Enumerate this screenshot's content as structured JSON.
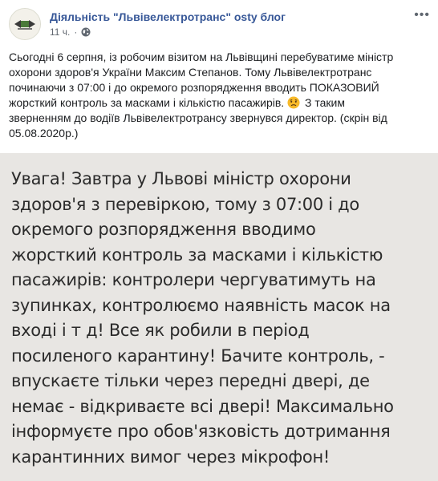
{
  "post": {
    "page_name": "Діяльність \"Львівелектротранс\" osty блог",
    "time": "11 ч.",
    "meta_separator": "·",
    "audience_icon": "globe-icon",
    "more_icon": "more-options-icon",
    "text_before_emoji": "Сьогодні 6 серпня, із робочим візитом на Львівщині перебуватиме міністр охорони здоров'я України Максим Степанов. Тому Львівелектротранс починаючи з 07:00 і до окремого розпорядження вводить ПОКАЗОВИЙ жорсткий контроль за масками і кількістю пасажирів.",
    "emoji_icon": "disappointed-face-icon",
    "text_after_emoji": "З таким зверненням до водіїв Львівелектротрансу звернувся директор. (скрін від 05.08.2020р.)"
  },
  "screenshot": {
    "text": "Увага! Завтра у Львові міністр охорони\nздоров'я з перевіркою, тому з 07:00  і до\nокремого розпорядження вводимо\nжорсткий контроль за масками і кількістю\nпасажирів: контролери чергуватимуть на\nзупинках, контролюємо наявність масок на\nвході і т д! Все як робили в період\nпосиленого карантину! Бачите контроль, -\nвпускаєте тільки через передні двері, де\nнемає - відкриваєте всі двері! Максимально\nінформуєте про обов'язковість дотримання\nкарантинних вимог через мікрофон!"
  },
  "colors": {
    "link": "#385898",
    "meta": "#606770",
    "body_text": "#1c1e21",
    "screenshot_bg": "#e8e6e3"
  }
}
